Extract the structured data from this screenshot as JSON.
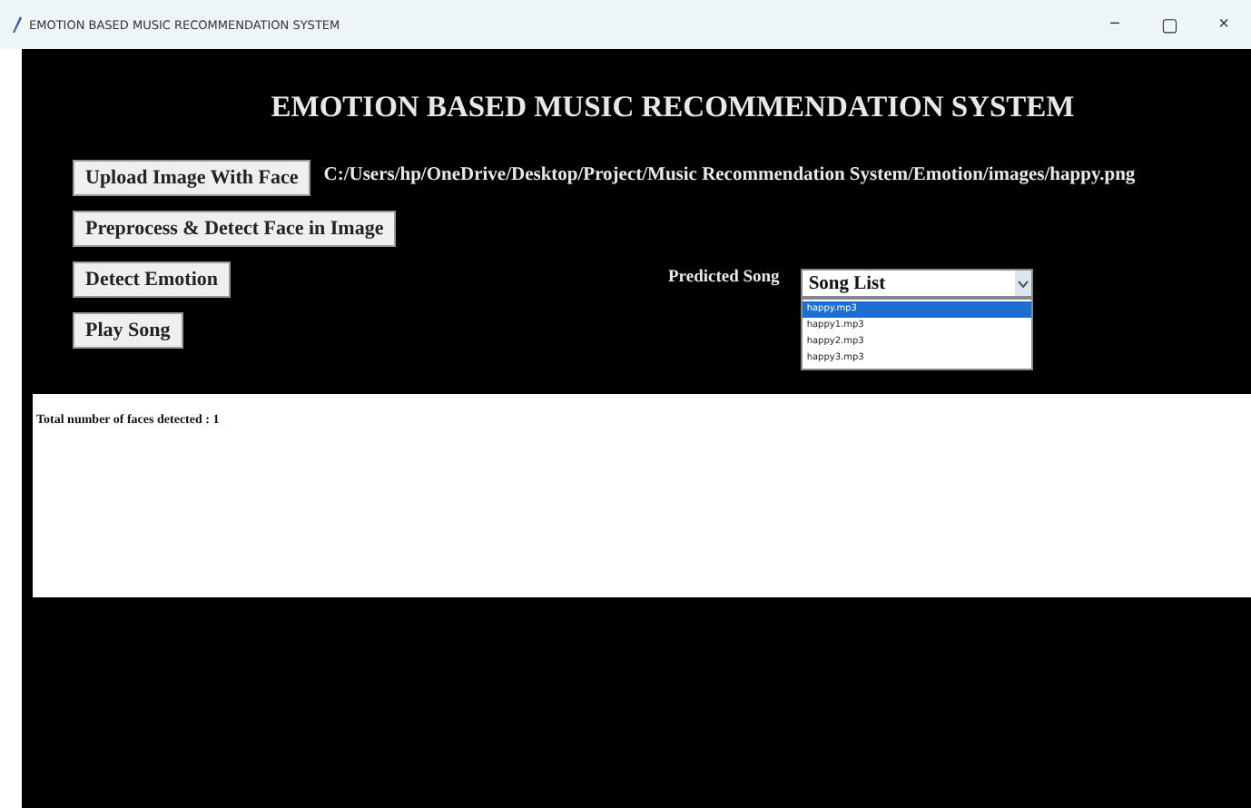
{
  "window": {
    "title": "EMOTION BASED MUSIC RECOMMENDATION SYSTEM",
    "controls": [
      "−",
      "▢",
      "×"
    ]
  },
  "heading": "EMOTION BASED MUSIC RECOMMENDATION SYSTEM",
  "buttons": [
    "Upload Image With Face",
    "Preprocess & Detect Face in Image",
    "Detect Emotion",
    "Play Song"
  ],
  "image_path": "C:/Users/hp/OneDrive/Desktop/Project/Music Recommendation System/Emotion/images/happy.png",
  "predicted_label": "Predicted Song",
  "song_select": {
    "value": "Song List",
    "expanded": true,
    "options": [
      {
        "label": "happy.mp3",
        "selected": true
      },
      {
        "label": "happy1.mp3",
        "selected": false
      },
      {
        "label": "happy2.mp3",
        "selected": false
      },
      {
        "label": "happy3.mp3",
        "selected": false
      }
    ]
  },
  "output": "Total number of faces detected : 1"
}
